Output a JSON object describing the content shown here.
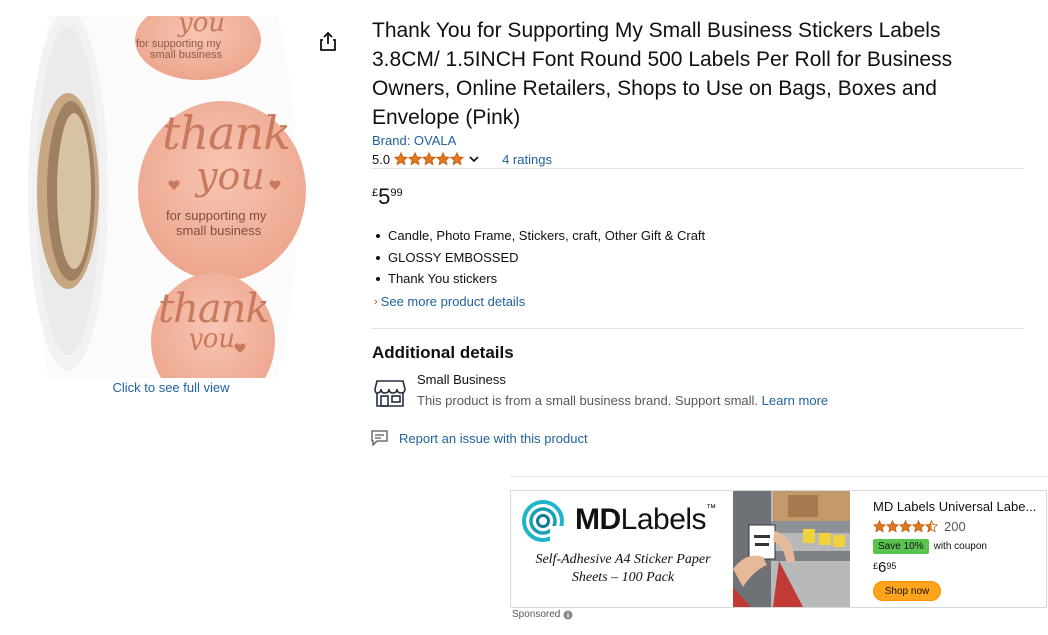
{
  "product": {
    "title": "Thank You for Supporting My Small Business Stickers Labels 3.8CM/ 1.5INCH Font Round 500 Labels Per Roll for Business Owners, Online Retailers, Shops to Use on Bags, Boxes and Envelope (Pink)",
    "brand_link": "Brand: OVALA",
    "rating_value": "5.0",
    "stars": 5,
    "ratings_count_label": "4 ratings",
    "price": {
      "symbol": "£",
      "whole": "5",
      "fraction": "99"
    },
    "bullets": [
      "Candle, Photo Frame, Stickers, craft, Other Gift & Craft",
      "GLOSSY EMBOSSED",
      "Thank You stickers"
    ],
    "see_more_label": "See more product details"
  },
  "image": {
    "sticker_text_1": "thank",
    "sticker_text_2": "you",
    "sticker_subtext_1": "for supporting my",
    "sticker_subtext_2": "small business",
    "click_full_view": "Click to see full view"
  },
  "additional": {
    "heading": "Additional details",
    "small_business_title": "Small Business",
    "small_business_desc": "This product is from a small business brand. Support small.",
    "learn_more": "Learn more",
    "report_issue": "Report an issue with this product"
  },
  "ad": {
    "logo_bold": "MD",
    "logo_light": "Labels",
    "logo_tm": "™",
    "tagline_1": "Self-Adhesive A4 Sticker Paper",
    "tagline_2": "Sheets – 100 Pack",
    "product_title": "MD Labels Universal Labe...",
    "stars": 4.5,
    "rating_count": "200",
    "save_badge": "Save 10%",
    "with_coupon": "with coupon",
    "price": {
      "symbol": "£",
      "whole": "6",
      "fraction": "95"
    },
    "shop_now": "Shop now",
    "sponsored": "Sponsored"
  },
  "colors": {
    "link": "#2162a1",
    "star": "#de7921",
    "sticker_pink": "#f4b5a0",
    "rose_gold": "#c97a5e",
    "shop_button": "#ffa41c",
    "save_badge": "#5ac34f"
  },
  "icons": {
    "share": "share-icon",
    "star": "star-icon",
    "chevron": "chevron-down-icon",
    "small_business": "storefront-icon",
    "report": "report-flag-icon",
    "info": "info-icon"
  }
}
